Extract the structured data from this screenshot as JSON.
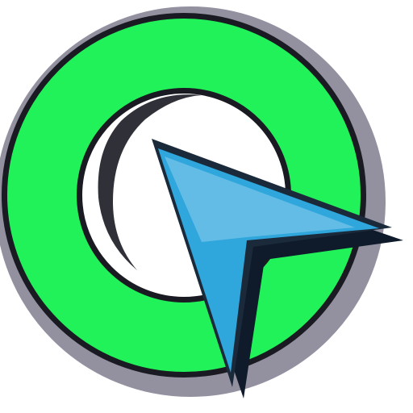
{
  "icon": {
    "name": "cursor-target-icon",
    "description_colors": {
      "ring": "#22f25a",
      "ring_outline": "#1a1a22",
      "ring_shadow": "#3a3552",
      "arrow": "#2fa6dc",
      "arrow_outline": "#1b2a3a",
      "arrow_shadow": "#0f1a2a",
      "background": "#ffffff"
    }
  }
}
